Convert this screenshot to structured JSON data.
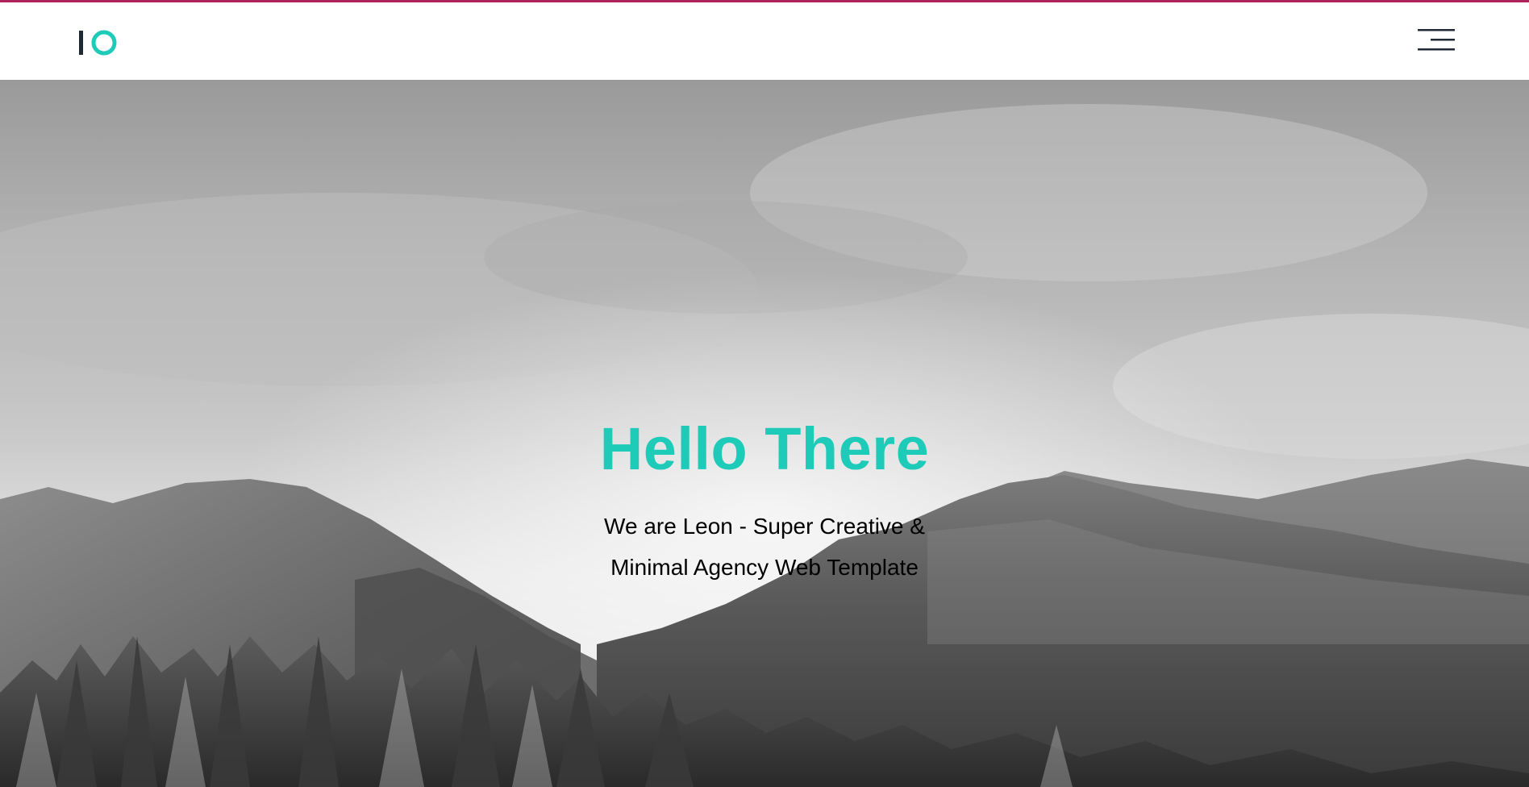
{
  "theme": {
    "accent": "#1ecbb9",
    "top_bar": "#b0245e",
    "logo_dark": "#1f2a36"
  },
  "header": {
    "logo_icon": "io-logo-icon",
    "menu_icon": "hamburger-menu-icon"
  },
  "hero": {
    "title": "Hello There",
    "subtitle_line1": "We are Leon - Super Creative &",
    "subtitle_line2": "Minimal Agency Web Template",
    "background": "mountain-landscape-image"
  }
}
